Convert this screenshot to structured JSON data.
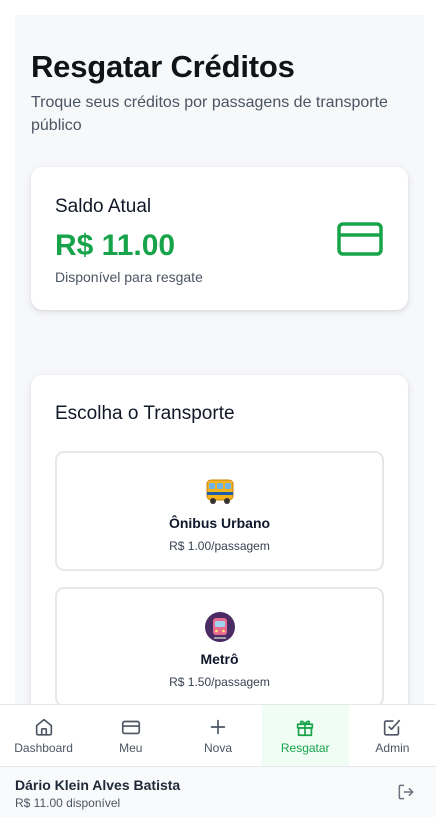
{
  "header": {
    "title": "Resgatar Créditos",
    "subtitle": "Troque seus créditos por passagens de transporte público"
  },
  "balance": {
    "label": "Saldo Atual",
    "value": "R$ 11.00",
    "note": "Disponível para resgate",
    "icon": "credit-card-icon",
    "accent_color": "#16a34a"
  },
  "transport": {
    "title": "Escolha o Transporte",
    "options": [
      {
        "name": "Ônibus Urbano",
        "price": "R$ 1.00/passagem",
        "icon": "bus-icon"
      },
      {
        "name": "Metrô",
        "price": "R$ 1.50/passagem",
        "icon": "metro-icon"
      }
    ]
  },
  "nav": {
    "items": [
      {
        "label": "Dashboard",
        "icon": "home-icon"
      },
      {
        "label": "Meu",
        "icon": "card-icon"
      },
      {
        "label": "Nova",
        "icon": "plus-icon"
      },
      {
        "label": "Resgatar",
        "icon": "gift-icon",
        "active": true
      },
      {
        "label": "Admin",
        "icon": "edit-square-icon"
      }
    ],
    "active_color": "#16a34a"
  },
  "user": {
    "name": "Dário Klein Alves Batista",
    "credit": "R$ 11.00 disponível",
    "logout_icon": "logout-icon"
  }
}
